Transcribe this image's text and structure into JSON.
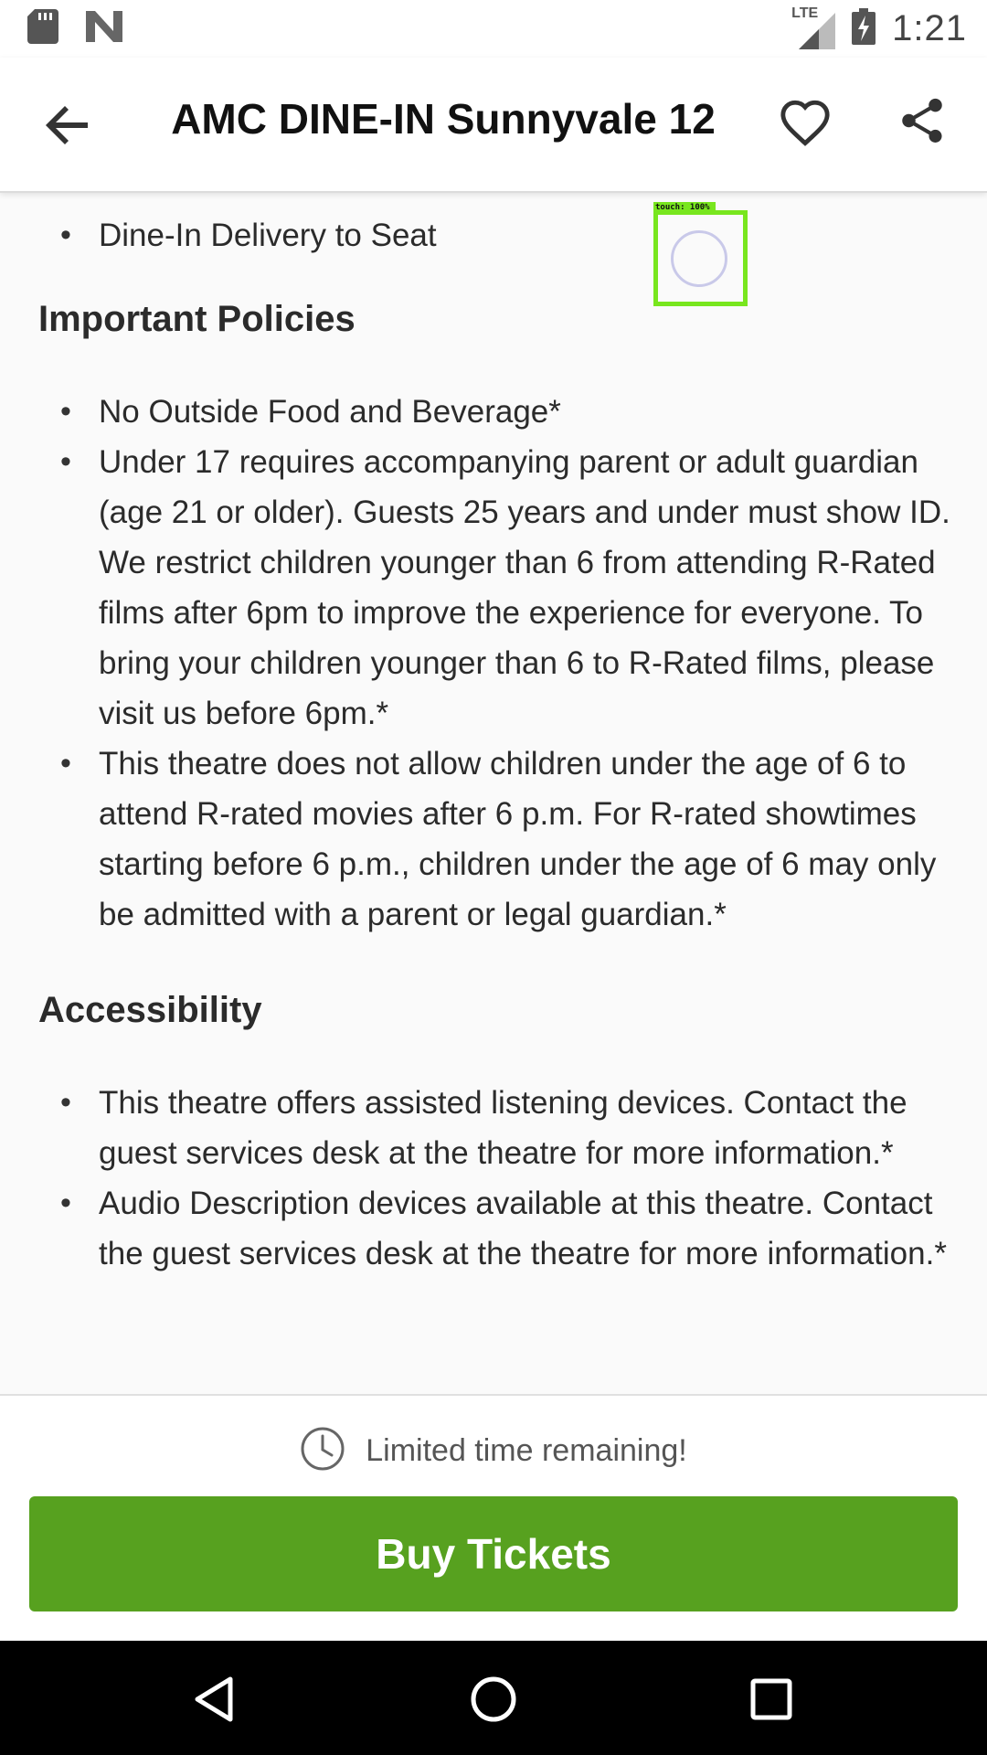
{
  "status_bar": {
    "network_label": "LTE",
    "time": "1:21"
  },
  "app_bar": {
    "title": "AMC DINE-IN Sunnyvale 12"
  },
  "content": {
    "amenities_partial": [
      "Dine-In Delivery to Seat"
    ],
    "important_policies": {
      "heading": "Important Policies",
      "items": [
        "No Outside Food and Beverage*",
        "Under 17 requires accompanying parent or adult guardian (age 21 or older). Guests 25 years and under must show ID. We restrict children younger than 6 from attending R-Rated films after 6pm to improve the experience for everyone. To bring your children younger than 6 to R-Rated films, please visit us before 6pm.*",
        "This theatre does not allow children under the age of 6 to attend R-rated movies after 6 p.m. For R-rated showtimes starting before 6 p.m., children under the age of 6 may only be admitted with a parent or legal guardian.*"
      ]
    },
    "accessibility": {
      "heading": "Accessibility",
      "items": [
        "This theatre offers assisted listening devices. Contact the guest services desk at the theatre for more information.*",
        "Audio Description devices available at this theatre. Contact the guest services desk at the theatre for more information.*"
      ]
    }
  },
  "touch_overlay": {
    "label": "touch: 100%"
  },
  "bottom_panel": {
    "limited_text": "Limited time remaining!",
    "buy_label": "Buy Tickets"
  },
  "colors": {
    "accent": "#57a11f",
    "touch_indicator": "#78e61e"
  },
  "icons": {
    "status": [
      "sd-card-icon",
      "n-logo-icon",
      "signal-icon",
      "battery-charging-icon"
    ],
    "app_bar": [
      "back-arrow-icon",
      "heart-icon",
      "share-icon"
    ],
    "bottom": [
      "clock-icon"
    ],
    "nav": [
      "nav-back-icon",
      "nav-home-icon",
      "nav-recents-icon"
    ]
  }
}
